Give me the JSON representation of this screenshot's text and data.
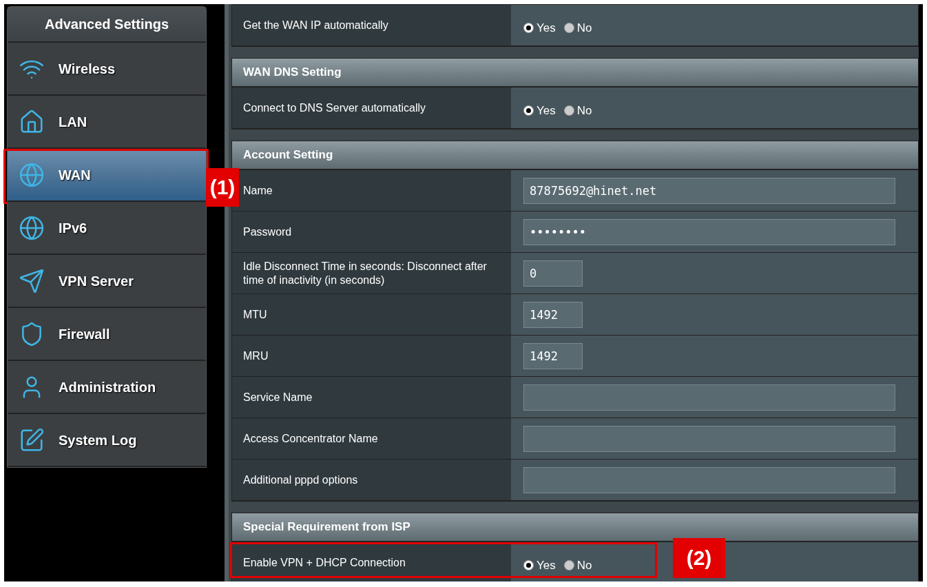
{
  "sidebar": {
    "title": "Advanced Settings",
    "items": [
      {
        "label": "Wireless",
        "selected": false,
        "highlighted": false
      },
      {
        "label": "LAN",
        "selected": false,
        "highlighted": false
      },
      {
        "label": "WAN",
        "selected": true,
        "highlighted": true,
        "callout": "(1)"
      },
      {
        "label": "IPv6",
        "selected": false,
        "highlighted": false
      },
      {
        "label": "VPN Server",
        "selected": false,
        "highlighted": false
      },
      {
        "label": "Firewall",
        "selected": false,
        "highlighted": false
      },
      {
        "label": "Administration",
        "selected": false,
        "highlighted": false
      },
      {
        "label": "System Log",
        "selected": false,
        "highlighted": false
      }
    ]
  },
  "sections": [
    {
      "rows": [
        {
          "label": "Get the WAN IP automatically",
          "kind": "radio",
          "highlighted": false,
          "options": [
            {
              "label": "Yes",
              "selected": true
            },
            {
              "label": "No",
              "selected": false
            }
          ]
        }
      ]
    },
    {
      "title": "WAN DNS Setting",
      "rows": [
        {
          "label": "Connect to DNS Server automatically",
          "kind": "radio",
          "highlighted": false,
          "options": [
            {
              "label": "Yes",
              "selected": true
            },
            {
              "label": "No",
              "selected": false
            }
          ]
        }
      ]
    },
    {
      "title": "Account Setting",
      "rows": [
        {
          "label": "Name",
          "kind": "text",
          "highlighted": false,
          "value": "87875692@hinet.net"
        },
        {
          "label": "Password",
          "kind": "text",
          "highlighted": false,
          "value": "••••••••"
        },
        {
          "label": "Idle Disconnect Time in seconds: Disconnect after time of inactivity (in seconds)",
          "kind": "number",
          "highlighted": false,
          "value": "0"
        },
        {
          "label": "MTU",
          "kind": "number",
          "highlighted": false,
          "value": "1492"
        },
        {
          "label": "MRU",
          "kind": "number",
          "highlighted": false,
          "value": "1492"
        },
        {
          "label": "Service Name",
          "kind": "text",
          "highlighted": false
        },
        {
          "label": "Access Concentrator Name",
          "kind": "text",
          "highlighted": false
        },
        {
          "label": "Additional pppd options",
          "kind": "text",
          "highlighted": false
        }
      ]
    },
    {
      "title": "Special Requirement from ISP",
      "rows": [
        {
          "label": "Enable VPN + DHCP Connection",
          "kind": "radio",
          "highlighted": true,
          "callout": "(2)",
          "options": [
            {
              "label": "Yes",
              "selected": true
            },
            {
              "label": "No",
              "selected": false
            }
          ]
        }
      ]
    }
  ]
}
